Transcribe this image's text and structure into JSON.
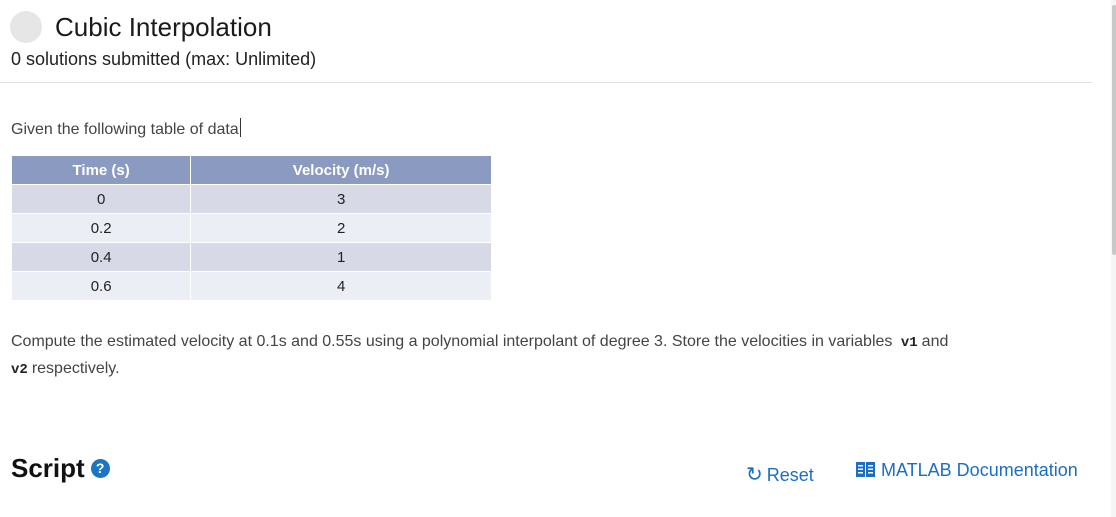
{
  "problem": {
    "title": "Cubic Interpolation",
    "submissions": "0 solutions submitted (max: Unlimited)"
  },
  "description": {
    "intro": "Given the following table of data",
    "table": {
      "headers": [
        "Time (s)",
        "Velocity (m/s)"
      ],
      "rows": [
        [
          "0",
          "3"
        ],
        [
          "0.2",
          "2"
        ],
        [
          "0.4",
          "1"
        ],
        [
          "0.6",
          "4"
        ]
      ]
    },
    "task_part1": "Compute the estimated velocity at 0.1s and 0.55s using a polynomial interpolant of degree 3. Store the velocities in variables",
    "var1": "v1",
    "task_and": "and",
    "var2": "v2",
    "task_part2": "respectively."
  },
  "script_section": {
    "heading": "Script",
    "help_glyph": "?",
    "reset_label": "Reset",
    "reset_glyph": "↻",
    "doc_label": "MATLAB Documentation"
  },
  "colors": {
    "accent": "#1b6ec2",
    "table_header": "#8b9ac0",
    "row_odd": "#d7dae6",
    "row_even": "#ebeef4"
  },
  "icons": [
    "status-circle-icon",
    "help-icon",
    "reset-icon",
    "book-icon"
  ]
}
